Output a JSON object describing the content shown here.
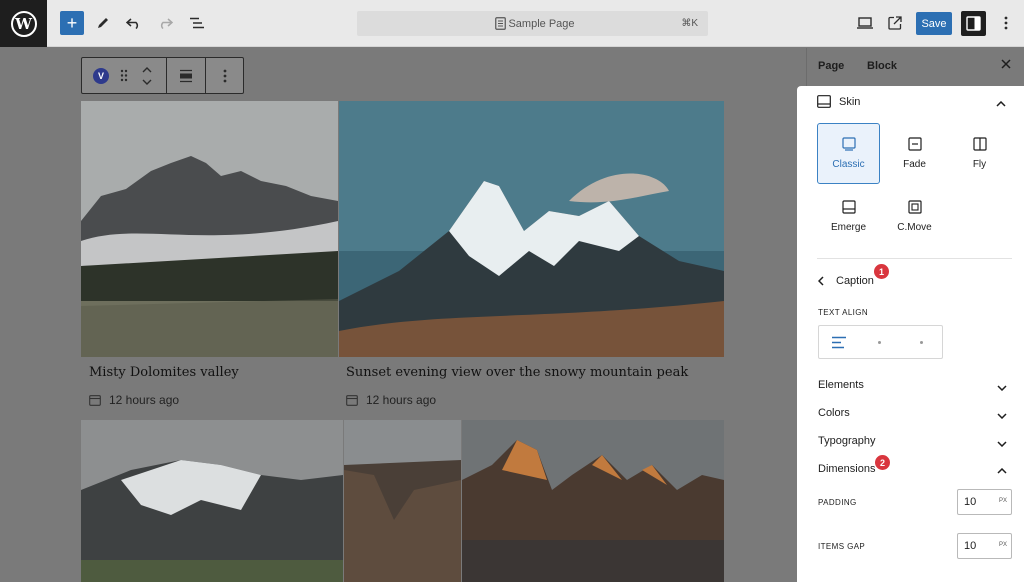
{
  "topbar": {
    "add_label": "+",
    "doc_title": "Sample Page",
    "shortcut": "⌘K",
    "save_label": "Save"
  },
  "block_toolbar": {
    "badge": "V"
  },
  "gallery": {
    "items": [
      {
        "title": "Misty Dolomites valley",
        "date": "12 hours ago"
      },
      {
        "title": "Sunset evening view over the snowy mountain peak",
        "date": "12 hours ago"
      }
    ]
  },
  "sidebar": {
    "tabs": [
      "Page",
      "Block"
    ],
    "active_tab": "Block",
    "skin": {
      "heading": "Skin",
      "options": [
        "Classic",
        "Fade",
        "Fly",
        "Emerge",
        "C.Move"
      ],
      "selected": "Classic"
    },
    "caption": {
      "heading": "Caption",
      "badge": "1",
      "text_align_label": "TEXT ALIGN"
    },
    "sections": [
      "Elements",
      "Colors",
      "Typography"
    ],
    "dimensions": {
      "heading": "Dimensions",
      "badge": "2",
      "padding_label": "PADDING",
      "padding_value": "10",
      "padding_unit": "PX",
      "gap_label": "ITEMS GAP",
      "gap_value": "10",
      "gap_unit": "PX"
    }
  },
  "colors": {
    "accent": "#2c6fb3",
    "badge": "#d9363e"
  }
}
